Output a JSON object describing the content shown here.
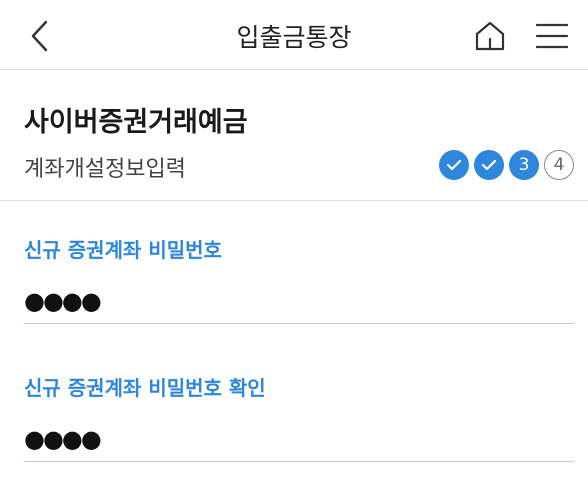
{
  "header": {
    "title": "입출금통장",
    "icons": {
      "back": "chevron-left-icon",
      "home": "home-icon",
      "menu": "hamburger-menu-icon"
    }
  },
  "product": {
    "name": "사이버증권거래예금",
    "step_label": "계좌개설정보입력"
  },
  "progress": {
    "current_step": 3,
    "total_steps": 4,
    "steps": [
      {
        "label": "✓",
        "state": "done"
      },
      {
        "label": "✓",
        "state": "done"
      },
      {
        "label": "3",
        "state": "current"
      },
      {
        "label": "4",
        "state": "todo"
      }
    ]
  },
  "form": {
    "password": {
      "label": "신규 증권계좌 비밀번호",
      "value": "●●●●"
    },
    "password_confirm": {
      "label": "신규 증권계좌 비밀번호 확인",
      "value": "●●●●"
    }
  },
  "colors": {
    "accent": "#2f87dc",
    "divider": "#dddddd",
    "field_underline": "#b9cfe8"
  }
}
